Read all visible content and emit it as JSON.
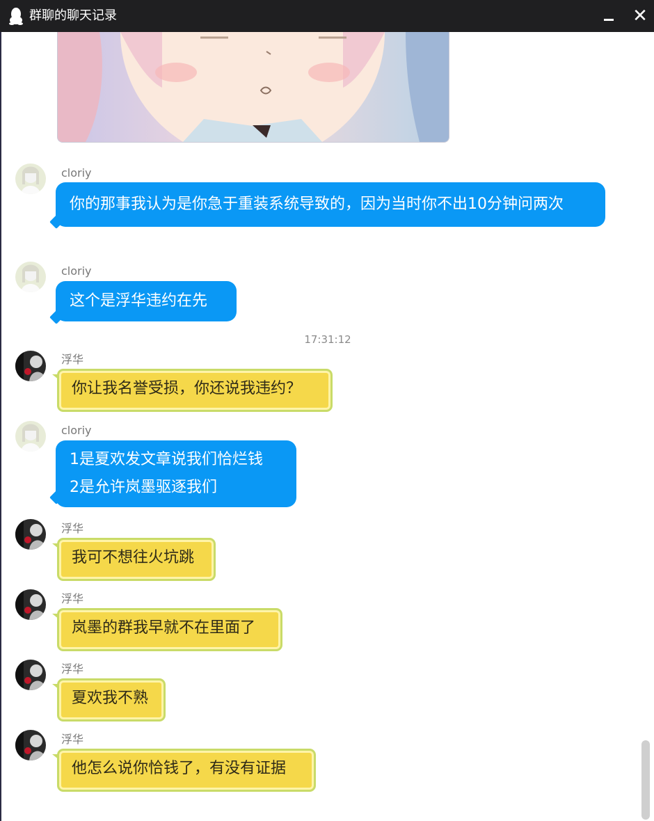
{
  "window": {
    "title": "群聊的聊天记录"
  },
  "timestamp": "17:31:12",
  "messages": [
    {
      "sender": "cloriy",
      "text": "你的那事我认为是你急于重装系统导致的，因为当时你不出10分钟问两次"
    },
    {
      "sender": "cloriy",
      "text": "这个是浮华违约在先"
    },
    {
      "sender": "浮华",
      "text": "你让我名誉受损，你还说我违约？"
    },
    {
      "sender": "cloriy",
      "lines": [
        "1是夏欢发文章说我们恰烂钱",
        "2是允许岚墨驱逐我们"
      ]
    },
    {
      "sender": "浮华",
      "text": "我可不想往火坑跳"
    },
    {
      "sender": "浮华",
      "text": "岚墨的群我早就不在里面了"
    },
    {
      "sender": "浮华",
      "text": "夏欢我不熟"
    },
    {
      "sender": "浮华",
      "text": "他怎么说你恰钱了，有没有证据"
    }
  ],
  "colors": {
    "blue_bubble": "#0a98f5",
    "yellow_bubble": "#f5d84a",
    "yellow_border": "#c9db68",
    "titlebar": "#1f1f21"
  },
  "icons": {
    "app": "qq-penguin-icon",
    "minimize": "minimize-icon",
    "close": "close-icon"
  }
}
